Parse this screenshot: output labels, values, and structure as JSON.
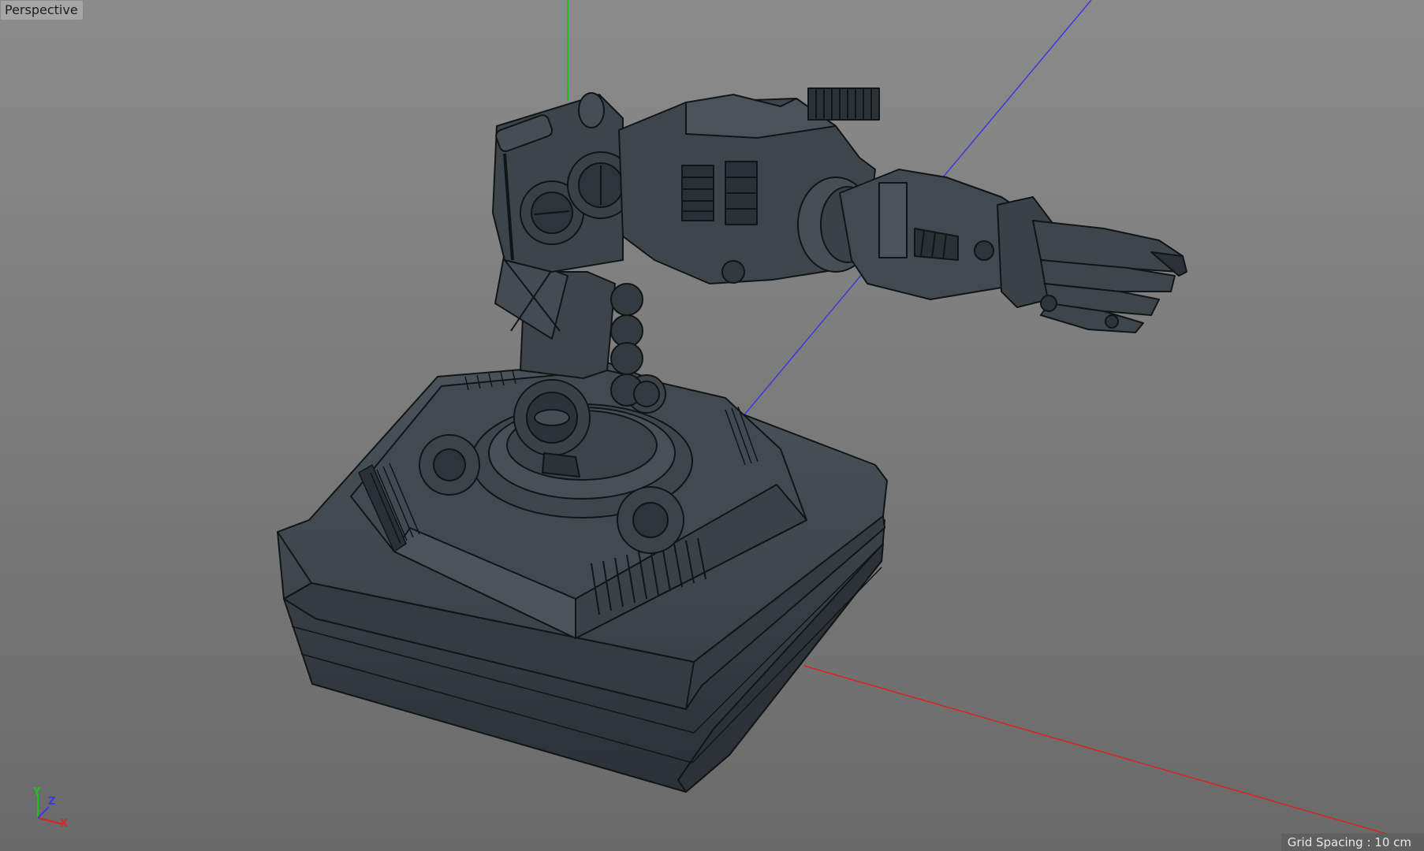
{
  "viewport": {
    "view_name": "Perspective",
    "grid_spacing": "Grid Spacing : 10 cm",
    "axes": {
      "x": {
        "label": "X",
        "color": "#d9241f"
      },
      "y": {
        "label": "Y",
        "color": "#21c020"
      },
      "z": {
        "label": "Z",
        "color": "#3a3ae0"
      }
    },
    "model": {
      "fill": "#3b4248",
      "edge": "#121517"
    }
  }
}
